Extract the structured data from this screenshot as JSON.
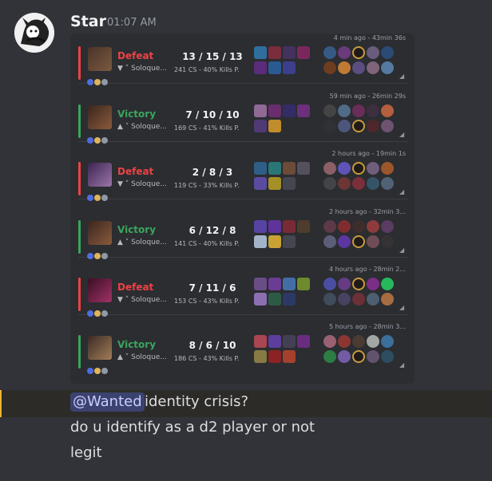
{
  "author": {
    "name": "Star",
    "timestamp": "01:07 AM"
  },
  "matches": [
    {
      "meta": "4 min ago - 43min 36s",
      "result": "Defeat",
      "result_color": "#ed4245",
      "kda": "13 / 15 / 13",
      "rank_text": "Soloque...",
      "stats": "241 CS - 40% Kills P."
    },
    {
      "meta": "59 min ago - 26min 29s",
      "result": "Victory",
      "result_color": "#3ba55d",
      "kda": "7 / 10 / 10",
      "rank_text": "Soloque...",
      "stats": "169 CS - 41% Kills P."
    },
    {
      "meta": "2 hours ago - 19min 1s",
      "result": "Defeat",
      "result_color": "#ed4245",
      "kda": "2 / 8 / 3",
      "rank_text": "Soloque...",
      "stats": "119 CS - 33% Kills P."
    },
    {
      "meta": "2 hours ago - 32min 3...",
      "result": "Victory",
      "result_color": "#3ba55d",
      "kda": "6 / 12 / 8",
      "rank_text": "Soloque...",
      "stats": "141 CS - 40% Kills P."
    },
    {
      "meta": "4 hours ago - 28min 2...",
      "result": "Defeat",
      "result_color": "#ed4245",
      "kda": "7 / 11 / 6",
      "rank_text": "Soloque...",
      "stats": "153 CS - 43% Kills P."
    },
    {
      "meta": "5 hours ago - 28min 3...",
      "result": "Victory",
      "result_color": "#3ba55d",
      "kda": "8 / 6 / 10",
      "rank_text": "Soloque...",
      "stats": "186 CS - 43% Kills P."
    }
  ],
  "message": {
    "mention": "@Wanted",
    "text": "identity crisis?",
    "line2": "do u identify as a d2 player or not",
    "line3": "legit"
  },
  "colors": {
    "background": "#313338",
    "embed": "#2b2d31",
    "highlight": "#f0b232"
  }
}
